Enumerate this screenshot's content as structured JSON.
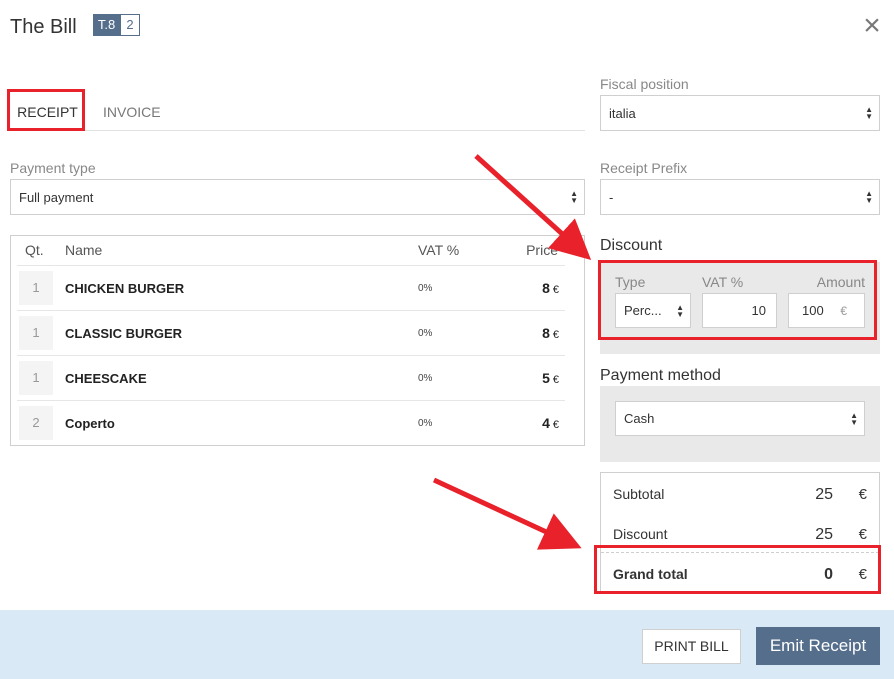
{
  "header": {
    "title": "The Bill",
    "table_badge": "T.8",
    "guests_badge": "2",
    "close_icon": "×"
  },
  "tabs": [
    {
      "label": "RECEIPT",
      "active": true
    },
    {
      "label": "INVOICE",
      "active": false
    }
  ],
  "payment_type": {
    "label": "Payment type",
    "value": "Full payment"
  },
  "table": {
    "columns": [
      "Qt.",
      "Name",
      "VAT %",
      "Price"
    ],
    "rows": [
      {
        "qty": "1",
        "name": "CHICKEN BURGER",
        "vat": "0%",
        "price": "8",
        "currency": "€"
      },
      {
        "qty": "1",
        "name": "CLASSIC BURGER",
        "vat": "0%",
        "price": "8",
        "currency": "€"
      },
      {
        "qty": "1",
        "name": "CHEESCAKE",
        "vat": "0%",
        "price": "5",
        "currency": "€"
      },
      {
        "qty": "2",
        "name": "Coperto",
        "vat": "0%",
        "price": "4",
        "currency": "€"
      }
    ]
  },
  "fiscal_position": {
    "label": "Fiscal position",
    "value": "italia"
  },
  "receipt_prefix": {
    "label": "Receipt Prefix",
    "value": "-"
  },
  "discount": {
    "title": "Discount",
    "type_label": "Type",
    "vat_label": "VAT %",
    "amount_label": "Amount",
    "type_value": "Perc...",
    "vat_value": "10",
    "amount_value": "100",
    "amount_currency": "€"
  },
  "payment_method": {
    "title": "Payment method",
    "value": "Cash"
  },
  "totals": {
    "subtotal_label": "Subtotal",
    "subtotal_value": "25",
    "discount_label": "Discount",
    "discount_value": "25",
    "grand_total_label": "Grand total",
    "grand_total_value": "0",
    "currency": "€"
  },
  "footer": {
    "print_label": "PRINT BILL",
    "emit_label": "Emit Receipt"
  },
  "colors": {
    "accent": "#546e8c",
    "footer_bg": "#d9e9f5",
    "annotation_red": "#e8212a"
  }
}
